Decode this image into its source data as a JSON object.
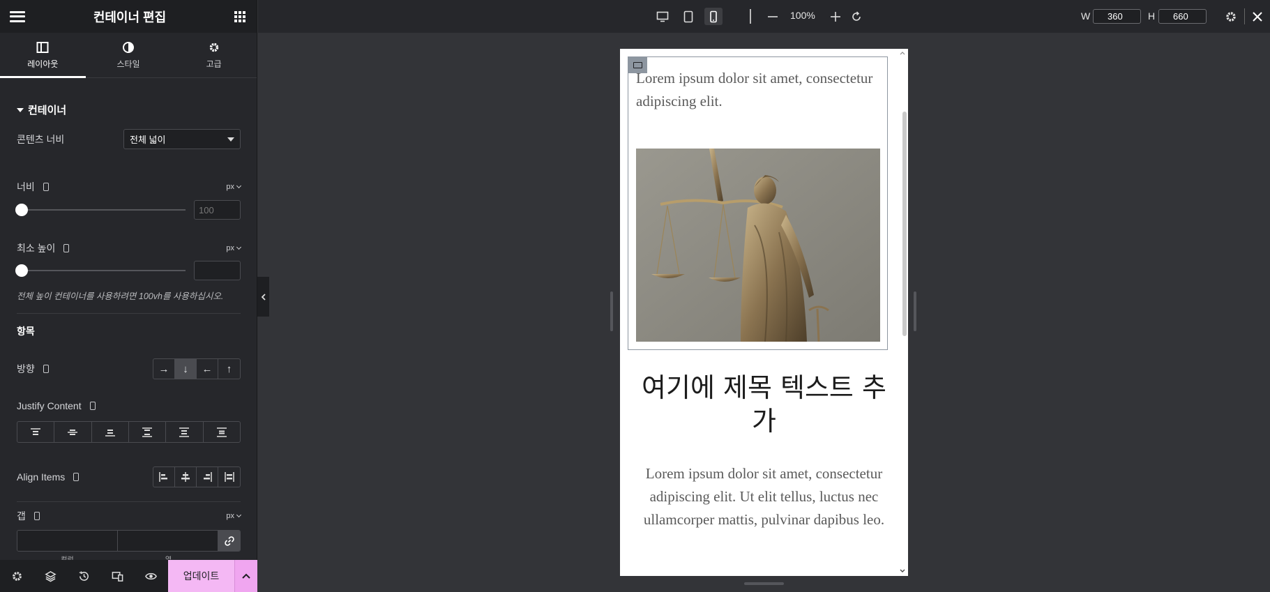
{
  "panel": {
    "title": "컨테이너 편집",
    "tabs": [
      {
        "label": "레이아웃",
        "icon": "layout-icon"
      },
      {
        "label": "스타일",
        "icon": "contrast-icon"
      },
      {
        "label": "고급",
        "icon": "gear-icon"
      }
    ],
    "section_container": "컨테이너",
    "content_width_label": "콘텐츠 너비",
    "content_width_value": "전체 넓이",
    "width_label": "너비",
    "width_unit": "px",
    "width_placeholder": "100",
    "min_height_label": "최소 높이",
    "min_height_unit": "px",
    "min_height_note": "전체 높이 컨테이너를 사용하려면 100vh를 사용하십시오.",
    "section_items": "항목",
    "direction_label": "방향",
    "direction_options": [
      "→",
      "↓",
      "←",
      "↑"
    ],
    "direction_active": 1,
    "justify_label": "Justify Content",
    "align_label": "Align Items",
    "gap_label": "갭",
    "gap_unit": "px",
    "gap_sublabels": [
      "컬럼",
      "열"
    ]
  },
  "footer": {
    "update_label": "업데이트"
  },
  "topbar": {
    "zoom": "100%",
    "w_label": "W",
    "w_value": "360",
    "h_label": "H",
    "h_value": "660"
  },
  "preview": {
    "lorem_top": "Lorem ipsum dolor sit amet, consectetur adipiscing elit.",
    "headline": "여기에 제목 텍스트 추가",
    "body": "Lorem ipsum dolor sit amet, consectetur adipiscing elit. Ut elit tellus, luctus nec ullamcorper mattis, pulvinar dapibus leo."
  },
  "colors": {
    "update_button": "#f4b8f4",
    "panel_bg": "#26272b",
    "canvas_bg": "#333438"
  }
}
